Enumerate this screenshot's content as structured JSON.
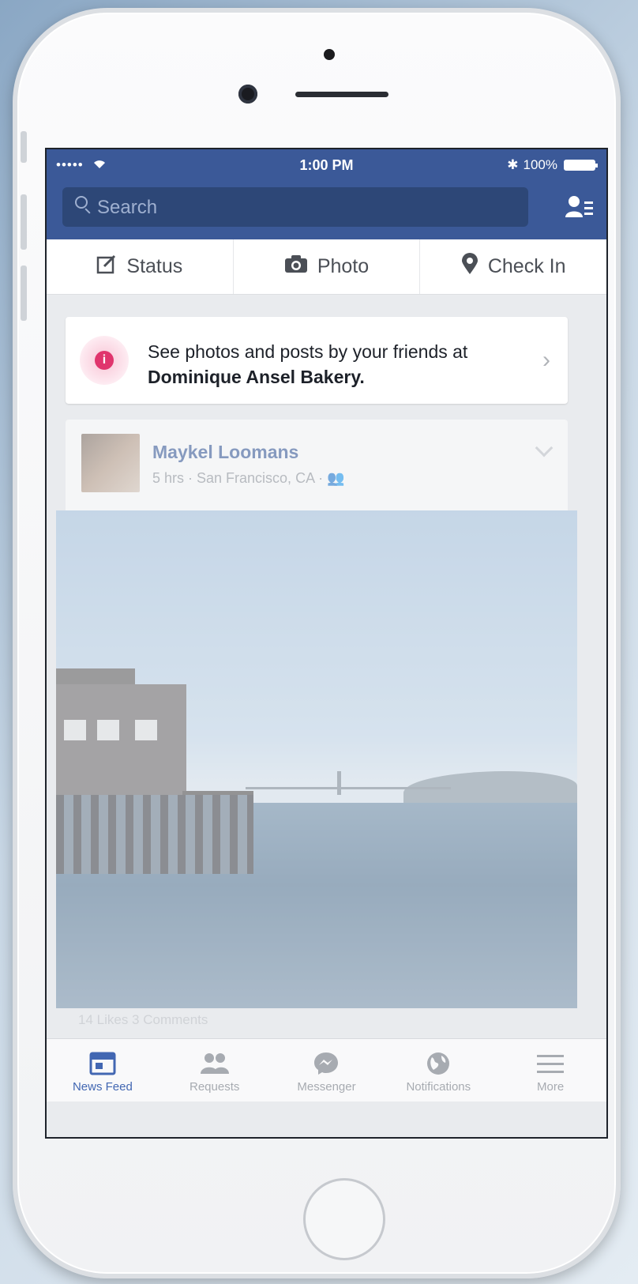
{
  "status_bar": {
    "signal": "•••••",
    "time": "1:00 PM",
    "battery": "100%"
  },
  "search": {
    "placeholder": "Search"
  },
  "composer": {
    "status_label": "Status",
    "photo_label": "Photo",
    "checkin_label": "Check In"
  },
  "info_card": {
    "text": "See photos and posts by your friends at",
    "place": "Dominique Ansel Bakery.",
    "badge": "i"
  },
  "post": {
    "author": "Maykel Loomans",
    "meta": "5 hrs · San Francisco, CA · ",
    "likes_text": "14 Likes  3 Comments"
  },
  "tabs": [
    {
      "label": "News Feed",
      "icon": "news-feed-icon"
    },
    {
      "label": "Requests",
      "icon": "requests-icon"
    },
    {
      "label": "Messenger",
      "icon": "messenger-icon"
    },
    {
      "label": "Notifications",
      "icon": "globe-icon"
    },
    {
      "label": "More",
      "icon": "menu-icon"
    }
  ],
  "colors": {
    "brand_blue": "#3b5998",
    "active_tab": "#4267b2",
    "info_badge": "#e0356d"
  }
}
